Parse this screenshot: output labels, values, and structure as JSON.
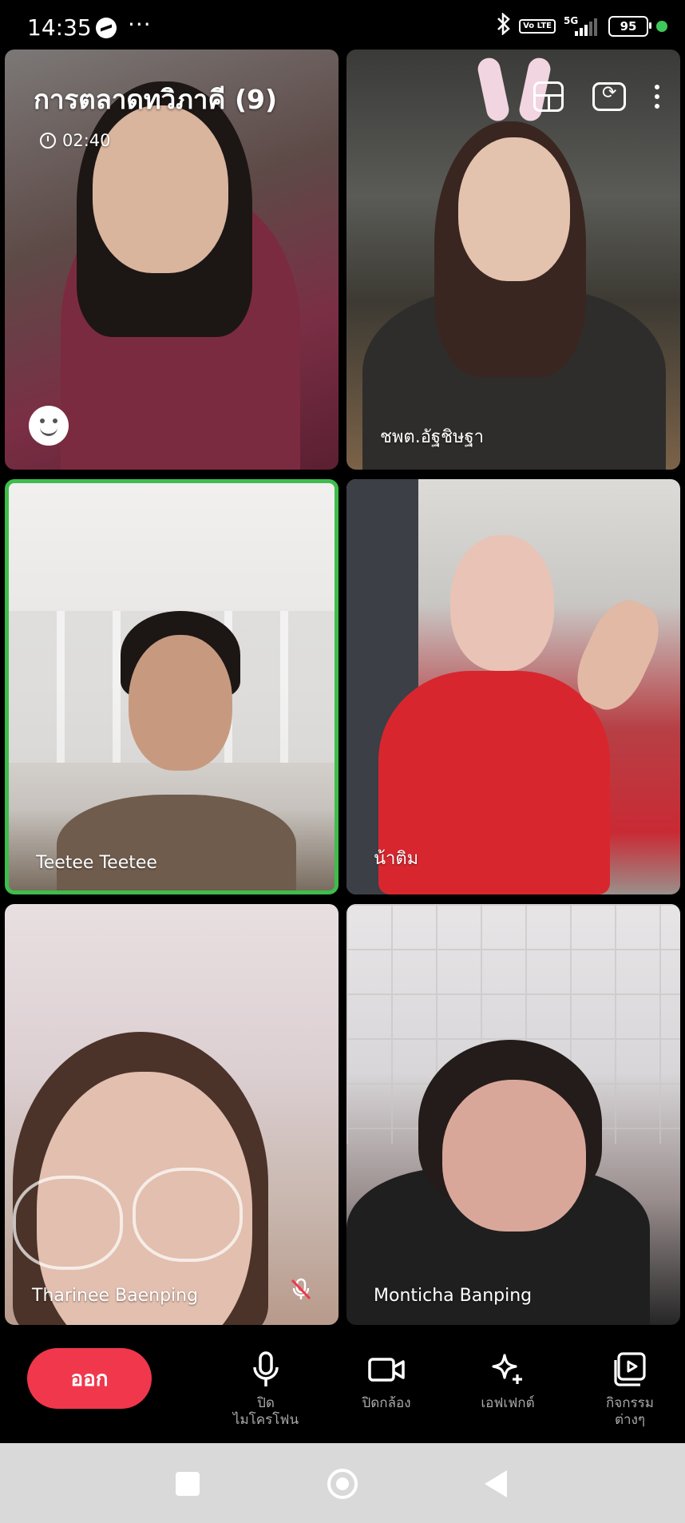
{
  "status_bar": {
    "time": "14:35",
    "dots": "···",
    "volte": "Vo LTE",
    "network": "5G",
    "battery": "95"
  },
  "call": {
    "title": "การตลาดทวิภาคี (9)",
    "timer": "02:40"
  },
  "participants": [
    {
      "name": ""
    },
    {
      "name": "ชพต.อัฐชิษฐา"
    },
    {
      "name": "Teetee Teetee",
      "speaking": true
    },
    {
      "name": "น้าติม"
    },
    {
      "name": "Tharinee Baenping",
      "muted": true
    },
    {
      "name": "Monticha Banping"
    }
  ],
  "controls": {
    "leave_label": "ออก",
    "mic_label_line1": "ปิด",
    "mic_label_line2": "ไมโครโฟน",
    "camera_label": "ปิดกล้อง",
    "effects_label": "เอฟเฟกต์",
    "activities_label_line1": "กิจกรรม",
    "activities_label_line2": "ต่างๆ"
  },
  "colors": {
    "leave": "#f0374b",
    "speaking_border": "#3ebd4c",
    "control_text": "#a9a9a9"
  }
}
